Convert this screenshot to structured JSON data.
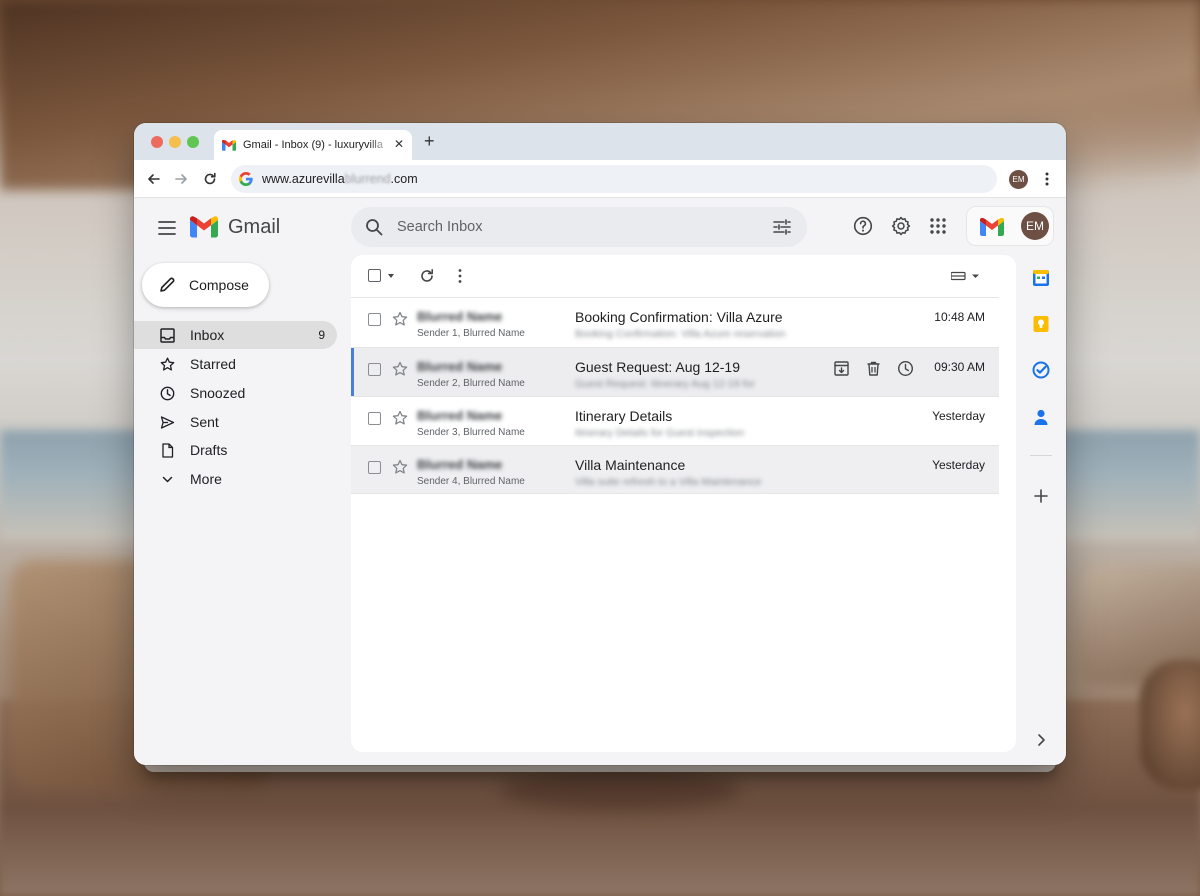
{
  "browser": {
    "tab_title": "Gmail - Inbox (9) - luxuryvilla",
    "tab_close": "✕",
    "new_tab": "+",
    "url_prefix": "www.azurevilla",
    "url_blurred": "blurrend",
    "url_suffix": ".com",
    "profile_initials": "EM"
  },
  "gmail": {
    "product_name": "Gmail",
    "search_placeholder": "Search Inbox",
    "account_initials": "EM",
    "compose_label": "Compose"
  },
  "nav": [
    {
      "label": "Inbox",
      "icon": "inbox-icon",
      "count": "9",
      "active": true
    },
    {
      "label": "Starred",
      "icon": "star-icon"
    },
    {
      "label": "Snoozed",
      "icon": "clock-icon"
    },
    {
      "label": "Sent",
      "icon": "send-icon"
    },
    {
      "label": "Drafts",
      "icon": "draft-icon"
    },
    {
      "label": "More",
      "icon": "chevron-down-icon"
    }
  ],
  "emails": [
    {
      "sender": "Blurred Name",
      "sender_sub_prefix": "Sender 1, ",
      "sender_sub_blur": "Blurred Name",
      "subject": "Booking Confirmation: Villa Azure",
      "snippet": "Booking Confirmation: Villa Azure reservation",
      "time": "10:48 AM"
    },
    {
      "sender": "Blurred Name",
      "sender_sub_prefix": "Sender 2, ",
      "sender_sub_blur": "Blurred Name",
      "subject": "Guest Request: Aug 12-19",
      "snippet": "Guest Request: Itinerary Aug 12-19 for",
      "time": "09:30 AM"
    },
    {
      "sender": "Blurred Name",
      "sender_sub_prefix": "Sender 3, ",
      "sender_sub_blur": "Blurred Name",
      "subject": "Itinerary Details",
      "snippet": "Itinerary Details for Guest inspection",
      "time": "Yesterday"
    },
    {
      "sender": "Blurred Name",
      "sender_sub_prefix": "Sender 4, ",
      "sender_sub_blur": "Blurred Name",
      "subject": "Villa Maintenance",
      "snippet": "Villa suite refresh to a Villa Maintenance",
      "time": "Yesterday"
    }
  ],
  "colors": {
    "accent_blue": "#4a7fd6",
    "avatar_brown": "#6d4f43",
    "gmail_red": "#ea4335"
  }
}
